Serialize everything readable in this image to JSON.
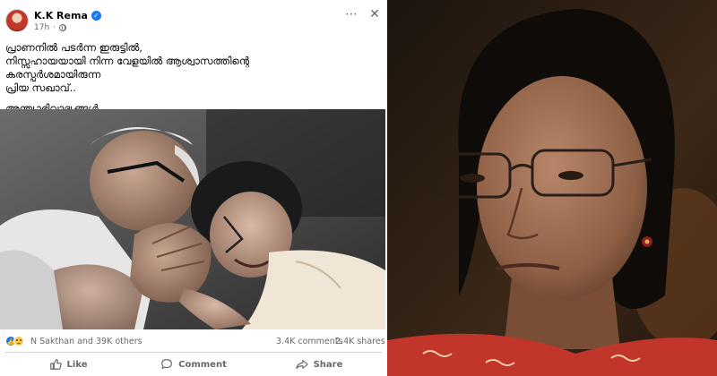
{
  "post": {
    "author": "K.K Rema",
    "time": "17h",
    "lines": [
      "പ്രാണനിൽ പടർന്ന ഇരുട്ടിൽ,",
      "നിസ്സഹായയായി നിന്ന വേളയിൽ ആശ്വാസത്തിന്റെ",
      "കരസ്പർശമായിരുന്ന",
      "പ്രിയ സഖാവ്.."
    ],
    "signoff": "അന്ത്യാഭിവാദ്യങ്ങൾ..",
    "image_icon": "photo-of-mourning-embrace",
    "reactions": {
      "icons": [
        "like-icon",
        "sad-icon"
      ],
      "names": "N Sakthan and 39K others",
      "comments": "3.4K comments",
      "shares": "2.4K shares"
    },
    "actions": {
      "like": "Like",
      "comment": "Comment",
      "share": "Share"
    },
    "colors": {
      "accent": "#1877f2",
      "muted": "#65676b"
    }
  },
  "portrait": {
    "description_icon": "portrait-photo"
  }
}
